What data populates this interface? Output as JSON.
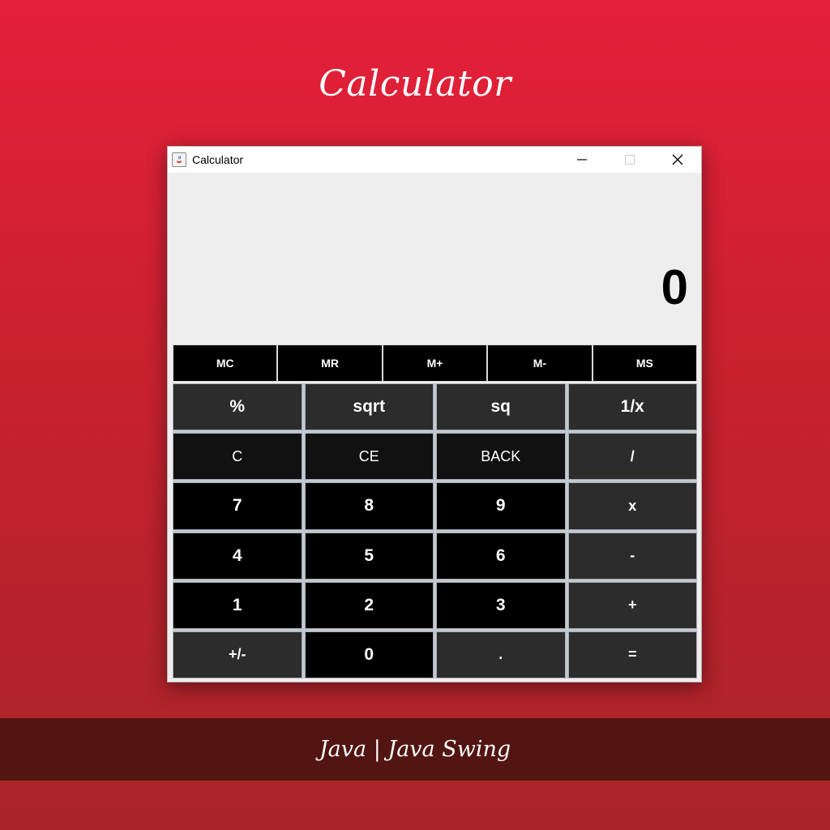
{
  "poster": {
    "title": "Calculator",
    "footer": "Java | Java Swing"
  },
  "window": {
    "title": "Calculator",
    "controls": [
      "minimize-icon",
      "maximize-icon",
      "close-icon"
    ]
  },
  "display": {
    "value": "0"
  },
  "memory": [
    "MC",
    "MR",
    "M+",
    "M-",
    "MS"
  ],
  "keys": [
    [
      "%",
      "sqrt",
      "sq",
      "1/x"
    ],
    [
      "C",
      "CE",
      "BACK",
      "/"
    ],
    [
      "7",
      "8",
      "9",
      "x"
    ],
    [
      "4",
      "5",
      "6",
      "-"
    ],
    [
      "1",
      "2",
      "3",
      "+"
    ],
    [
      "+/-",
      "0",
      ".",
      "="
    ]
  ],
  "colors": {
    "background_top": "#e5203a",
    "background_bottom": "#a8242a",
    "footer_band": "#521511",
    "button_black": "#000000",
    "button_gray": "#2c2c2c"
  }
}
